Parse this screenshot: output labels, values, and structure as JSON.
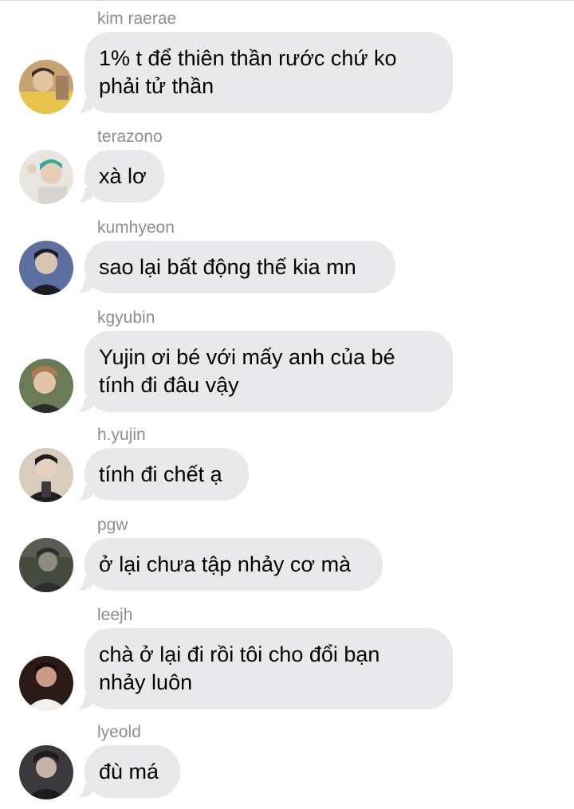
{
  "messages": [
    {
      "sender": "kim raerae",
      "avatar": "avatar-kim-raerae",
      "lines": [
        "1% t để thiên thần rước chứ ko",
        "phải tử thần"
      ],
      "avatar_colors": [
        "#c8a372",
        "#e8c44a",
        "#7a5a3c"
      ]
    },
    {
      "sender": "terazono",
      "avatar": "avatar-terazono",
      "lines": [
        "xà lơ"
      ],
      "avatar_colors": [
        "#3aa59a",
        "#e9e5e0",
        "#2a3b3a"
      ]
    },
    {
      "sender": "kumhyeon",
      "avatar": "avatar-kumhyeon",
      "lines": [
        "sao lại bất động thế kia mn"
      ],
      "avatar_colors": [
        "#5d6fa0",
        "#1c1c22",
        "#d9c4b4"
      ]
    },
    {
      "sender": "kgyubin",
      "avatar": "avatar-kgyubin",
      "lines": [
        "Yujin ơi bé với mấy anh của bé",
        "tính đi đâu vậy"
      ],
      "avatar_colors": [
        "#6b7b58",
        "#b07a4a",
        "#2a2a2a"
      ]
    },
    {
      "sender": "h.yujin",
      "avatar": "avatar-h-yujin",
      "lines": [
        "tính đi chết ạ"
      ],
      "avatar_colors": [
        "#d8ccbc",
        "#1f1f22",
        "#e6d1c0"
      ]
    },
    {
      "sender": "pgw",
      "avatar": "avatar-pgw",
      "lines": [
        "ở lại chưa tập nhảy cơ mà"
      ],
      "avatar_colors": [
        "#444a3e",
        "#2d2d2d",
        "#8f8c80"
      ]
    },
    {
      "sender": "leejh",
      "avatar": "avatar-leejh",
      "lines": [
        "chà ở lại đi rồi tôi cho đổi bạn",
        "nhảy luôn"
      ],
      "avatar_colors": [
        "#2a1a18",
        "#f3f1ee",
        "#c89a84"
      ]
    },
    {
      "sender": "lyeold",
      "avatar": "avatar-lyeold",
      "lines": [
        "đù má"
      ],
      "avatar_colors": [
        "#3a3a3e",
        "#1c1c1f",
        "#c7b2a6"
      ]
    }
  ],
  "colors": {
    "bubble": "#e9e9eb",
    "sender_name": "#8e8e93",
    "text": "#000000",
    "divider": "#d6d6da"
  }
}
